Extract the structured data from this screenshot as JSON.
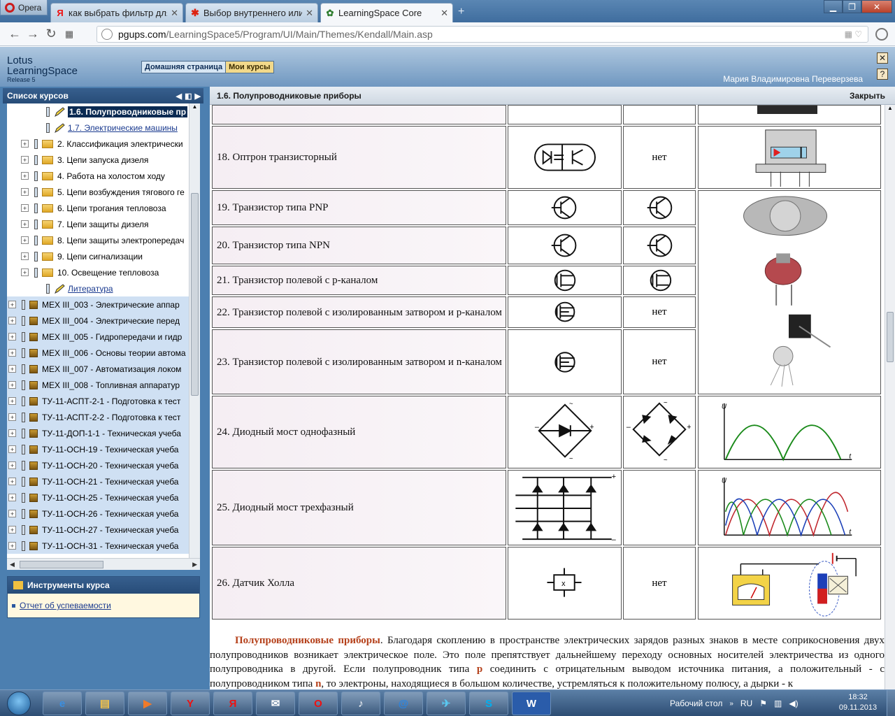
{
  "browser": {
    "menu_label": "Opera",
    "tabs": [
      {
        "title": "как выбрать фильтр для с",
        "favicon": "Я"
      },
      {
        "title": "Выбор внутреннего или н",
        "favicon": "✱"
      },
      {
        "title": "LearningSpace Core",
        "favicon": "✿"
      }
    ],
    "address_host": "pgups.com",
    "address_path": "/LearningSpace5/Program/UI/Main/Themes/Kendall/Main.asp"
  },
  "ls": {
    "logo_line1": "Lotus",
    "logo_line2": "LearningSpace",
    "logo_release": "Release 5",
    "home_button": "Домашняя страница",
    "courses_button": "Мои курсы",
    "user_name": "Мария Владимировна Переверзева"
  },
  "sidebar": {
    "title": "Список курсов",
    "items": [
      {
        "label": "1.6. Полупроводниковые пр",
        "kind": "current"
      },
      {
        "label": "1.7. Электрические машины",
        "kind": "link"
      },
      {
        "label": "2. Классификация электрически",
        "kind": "folder"
      },
      {
        "label": "3. Цепи запуска дизеля",
        "kind": "folder"
      },
      {
        "label": "4. Работа на холостом ходу",
        "kind": "folder"
      },
      {
        "label": "5. Цепи возбуждения тягового ге",
        "kind": "folder"
      },
      {
        "label": "6. Цепи трогания тепловоза",
        "kind": "folder"
      },
      {
        "label": "7. Цепи защиты дизеля",
        "kind": "folder"
      },
      {
        "label": "8. Цепи защиты электропередач",
        "kind": "folder"
      },
      {
        "label": "9. Цепи сигнализации",
        "kind": "folder"
      },
      {
        "label": "10. Освещение тепловоза",
        "kind": "folder"
      },
      {
        "label": "Литература",
        "kind": "link"
      },
      {
        "label": "МЕХ III_003 - Электрические аппар",
        "kind": "course"
      },
      {
        "label": "МЕХ III_004 - Электрические перед",
        "kind": "course"
      },
      {
        "label": "МЕХ III_005 - Гидропередачи и гидр",
        "kind": "course"
      },
      {
        "label": "МЕХ III_006 - Основы теории автома",
        "kind": "course"
      },
      {
        "label": "МЕХ III_007 - Автоматизация локом",
        "kind": "course"
      },
      {
        "label": "МЕХ III_008 - Топливная аппаратур",
        "kind": "course"
      },
      {
        "label": "ТУ-11-АСПТ-2-1 - Подготовка к тест",
        "kind": "course"
      },
      {
        "label": "ТУ-11-АСПТ-2-2 - Подготовка к тест",
        "kind": "course"
      },
      {
        "label": "ТУ-11-ДОП-1-1 - Техническая учеба",
        "kind": "course"
      },
      {
        "label": "ТУ-11-ОСН-19 - Техническая учеба",
        "kind": "course"
      },
      {
        "label": "ТУ-11-ОСН-20 - Техническая учеба",
        "kind": "course"
      },
      {
        "label": "ТУ-11-ОСН-21 - Техническая учеба",
        "kind": "course"
      },
      {
        "label": "ТУ-11-ОСН-25 - Техническая учеба",
        "kind": "course"
      },
      {
        "label": "ТУ-11-ОСН-26 - Техническая учеба",
        "kind": "course"
      },
      {
        "label": "ТУ-11-ОСН-27 - Техническая учеба",
        "kind": "course"
      },
      {
        "label": "ТУ-11-ОСН-31 - Техническая учеба",
        "kind": "course"
      }
    ],
    "tools_title": "Инструменты курса",
    "tools_link": "Отчет об успеваемости"
  },
  "content": {
    "title": "1.6. Полупроводниковые приборы",
    "close_label": "Закрыть",
    "rows": [
      {
        "name": "18. Оптрон транзисторный",
        "alt": "нет"
      },
      {
        "name": "19. Транзистор типа PNP",
        "alt": ""
      },
      {
        "name": "20. Транзистор типа NPN",
        "alt": ""
      },
      {
        "name": "21. Транзистор полевой с р-каналом",
        "alt": ""
      },
      {
        "name": "22. Транзистор полевой с изолированным затвором и р-каналом",
        "alt": "нет"
      },
      {
        "name": "23. Транзистор полевой с изолированным затвором и n-каналом",
        "alt": "нет"
      },
      {
        "name": "24. Диодный мост однофазный",
        "alt": ""
      },
      {
        "name": "25. Диодный мост трехфазный",
        "alt": ""
      },
      {
        "name": "26. Датчик Холла",
        "alt": "нет"
      }
    ],
    "para_bold": "Полупроводниковые приборы",
    "para_1": ". Благодаря скоплению в пространстве электрических зарядов разных знаков в месте соприкосновения двух полупроводников возникает электрическое поле. Это поле препятствует дальнейшему переходу основных носителей электричества из одного полупроводника в другой. Если полупроводник типа ",
    "para_p": "р",
    "para_2": " соединить с отрицательным выводом источника питания, а положительный - с полупроводником типа ",
    "para_n": "n",
    "para_3": ", то электроны, находящиеся в большом количестве, устремляться к положительному полюсу, а дырки - к"
  },
  "taskbar": {
    "desktop_label": "Рабочий стол",
    "lang": "RU",
    "time": "18:32",
    "date": "09.11.2013"
  }
}
